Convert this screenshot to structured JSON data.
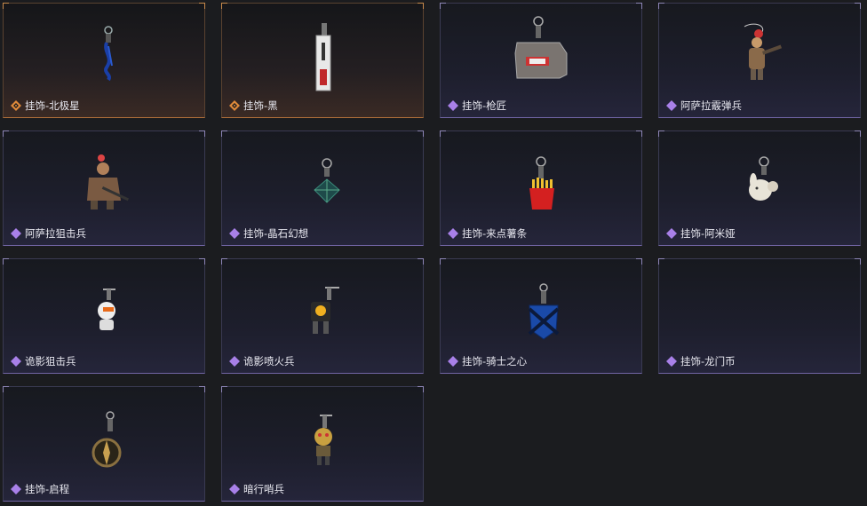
{
  "items": [
    {
      "label": "挂饰-北极星",
      "rarity": "gold",
      "icon": "polaris-charm-icon"
    },
    {
      "label": "挂饰-黑",
      "rarity": "gold",
      "icon": "black-tag-charm-icon"
    },
    {
      "label": "挂饰-枪匠",
      "rarity": "purple",
      "icon": "gunsmith-charm-icon"
    },
    {
      "label": "阿萨拉霰弹兵",
      "rarity": "purple",
      "icon": "shotgunner-figure-icon"
    },
    {
      "label": "阿萨拉狙击兵",
      "rarity": "purple",
      "icon": "sniper-figure-icon"
    },
    {
      "label": "挂饰-晶石幻想",
      "rarity": "purple",
      "icon": "crystal-cube-charm-icon"
    },
    {
      "label": "挂饰-来点薯条",
      "rarity": "purple",
      "icon": "fries-charm-icon"
    },
    {
      "label": "挂饰-阿米娅",
      "rarity": "purple",
      "icon": "bunny-charm-icon"
    },
    {
      "label": "诡影狙击兵",
      "rarity": "purple",
      "icon": "shadow-sniper-charm-icon"
    },
    {
      "label": "诡影喷火兵",
      "rarity": "purple",
      "icon": "shadow-flamer-charm-icon"
    },
    {
      "label": "挂饰-骑士之心",
      "rarity": "purple",
      "icon": "knight-heart-charm-icon"
    },
    {
      "label": "挂饰-龙门币",
      "rarity": "purple",
      "icon": "lungmen-coin-charm-icon"
    },
    {
      "label": "挂饰-启程",
      "rarity": "purple",
      "icon": "departure-compass-charm-icon"
    },
    {
      "label": "暗行哨兵",
      "rarity": "purple",
      "icon": "dark-sentry-figure-icon"
    }
  ],
  "colors": {
    "gold_rarity": "#e08a3a",
    "purple_rarity": "#a880e8",
    "background": "#1b1c1f"
  }
}
